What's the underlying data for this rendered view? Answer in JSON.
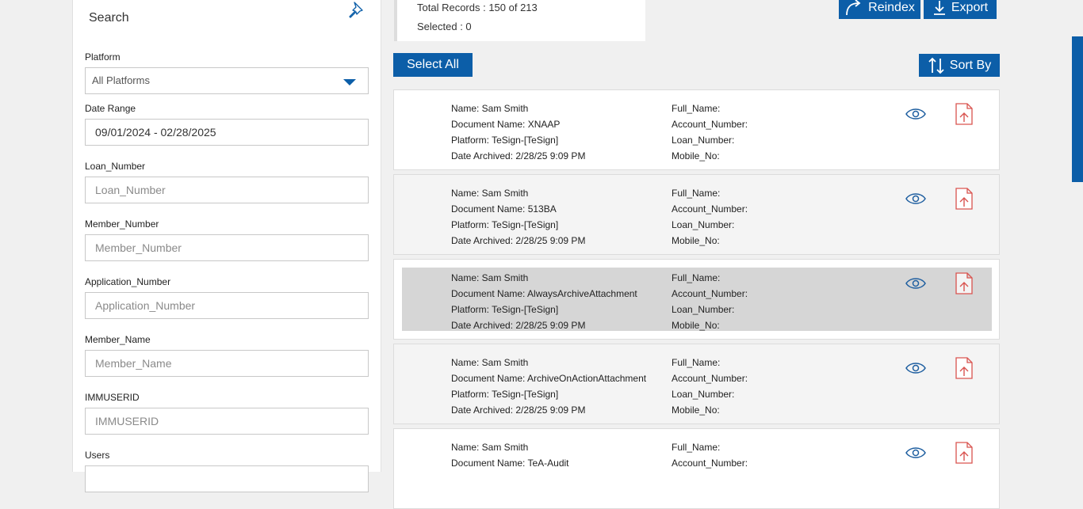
{
  "search": {
    "title": "Search",
    "platform": {
      "label": "Platform",
      "value": "All Platforms"
    },
    "date_range": {
      "label": "Date Range",
      "value": "09/01/2024 - 02/28/2025"
    },
    "fields": [
      {
        "label": "Loan_Number",
        "placeholder": "Loan_Number"
      },
      {
        "label": "Member_Number",
        "placeholder": "Member_Number"
      },
      {
        "label": "Application_Number",
        "placeholder": "Application_Number"
      },
      {
        "label": "Member_Name",
        "placeholder": "Member_Name"
      },
      {
        "label": "IMMUSERID",
        "placeholder": "IMMUSERID"
      }
    ],
    "users_label": "Users"
  },
  "summary": {
    "total": "Total Records : 150 of 213",
    "selected": "Selected : 0"
  },
  "toolbar": {
    "reindex_label": "Reindex",
    "export_label": "Export",
    "select_all_label": "Select All",
    "sort_by_label": "Sort By"
  },
  "records": [
    {
      "name": "Name: Sam Smith",
      "doc": "Document Name: XNAAP",
      "platform": "Platform: TeSign-[TeSign]",
      "date": "Date Archived: 2/28/25 9:09 PM",
      "full_name": "Full_Name:",
      "account": "Account_Number:",
      "loan": "Loan_Number:",
      "mobile": "Mobile_No:"
    },
    {
      "name": "Name: Sam Smith",
      "doc": "Document Name: 513BA",
      "platform": "Platform: TeSign-[TeSign]",
      "date": "Date Archived: 2/28/25 9:09 PM",
      "full_name": "Full_Name:",
      "account": "Account_Number:",
      "loan": "Loan_Number:",
      "mobile": "Mobile_No:"
    },
    {
      "name": "Name: Sam Smith",
      "doc": "Document Name: AlwaysArchiveAttachment",
      "platform": "Platform: TeSign-[TeSign]",
      "date": "Date Archived: 2/28/25 9:09 PM",
      "full_name": "Full_Name:",
      "account": "Account_Number:",
      "loan": "Loan_Number:",
      "mobile": "Mobile_No:"
    },
    {
      "name": "Name: Sam Smith",
      "doc": "Document Name: ArchiveOnActionAttachment",
      "platform": "Platform: TeSign-[TeSign]",
      "date": "Date Archived: 2/28/25 9:09 PM",
      "full_name": "Full_Name:",
      "account": "Account_Number:",
      "loan": "Loan_Number:",
      "mobile": "Mobile_No:"
    },
    {
      "name": "Name: Sam Smith",
      "doc": "Document Name: TeA-Audit",
      "platform": "",
      "date": "",
      "full_name": "Full_Name:",
      "account": "Account_Number:",
      "loan": "",
      "mobile": ""
    }
  ],
  "colors": {
    "accent": "#0c5ea8",
    "pdf": "#d9534f",
    "highlight": "#d6d6d6"
  },
  "icons": {
    "pin": "pin-icon",
    "view": "eye-icon",
    "file": "pdf-icon",
    "reindex": "reindex-icon",
    "export": "download-icon",
    "sort": "sort-icon"
  }
}
